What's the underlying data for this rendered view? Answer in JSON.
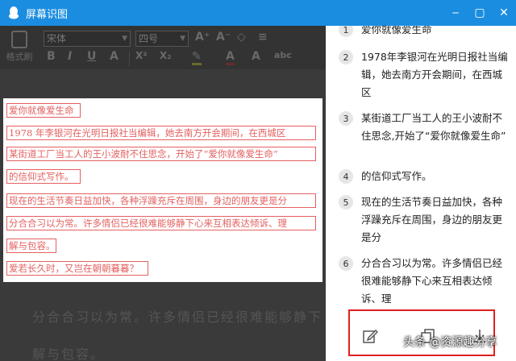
{
  "window": {
    "title": "屏幕识图",
    "controls": [
      "‒",
      "▢",
      "✕"
    ]
  },
  "toolbar": {
    "format_painter_label": "格式刷",
    "font_name": "宋体",
    "font_size": "四号",
    "buttons": [
      "A⁺",
      "A⁻",
      "◇",
      "≡",
      "B",
      "I",
      "U",
      "A",
      "X²",
      "X₂",
      "A",
      "A",
      "abc"
    ]
  },
  "background_text": [
    "分合合习以为常。许多情侣已经很难能够静下",
    "解与包容。"
  ],
  "captured_lines": [
    "爱你就像爱生命",
    "1978 年李银河在光明日报社当编辑，她去南方开会期间，在西城区",
    "某街道工厂当工人的王小波耐不住思念，开始了“爱你就像爱生命”",
    "的信仰式写作。",
    "现在的生活节奏日益加快，各种浮躁充斥在周围，身边的朋友更是分",
    "分合合习以为常。许多情侣已经很难能够静下心来互相表达倾诉、理",
    "解与包容。",
    "爱若长久时，又岂在朝朝暮暮？"
  ],
  "results": [
    {
      "num": "1",
      "text": "爱你就像爱生命"
    },
    {
      "num": "2",
      "text": "1978年李银河在光明日报社当编辑，她去南方开会期间，在西城区"
    },
    {
      "num": "3",
      "text": "某街道工厂当工人的王小波耐不住思念,开始了“爱你就像爱生命”"
    },
    {
      "num": "4",
      "text": "的信仰式写作。"
    },
    {
      "num": "5",
      "text": "现在的生活节奏日益加快，各种浮躁充斥在周围，身边的朋友更是分"
    },
    {
      "num": "6",
      "text": "分合合习以为常。许多情侣已经很难能够静下心来互相表达倾诉、理"
    }
  ],
  "icons": {
    "edit": "edit-icon",
    "copy": "copy-icon",
    "download": "download-icon"
  },
  "watermark": "头条 @资源趣分享",
  "colors": {
    "titlebar": "#1b8de0",
    "highlight": "#e46060",
    "action_border": "#e02020"
  }
}
